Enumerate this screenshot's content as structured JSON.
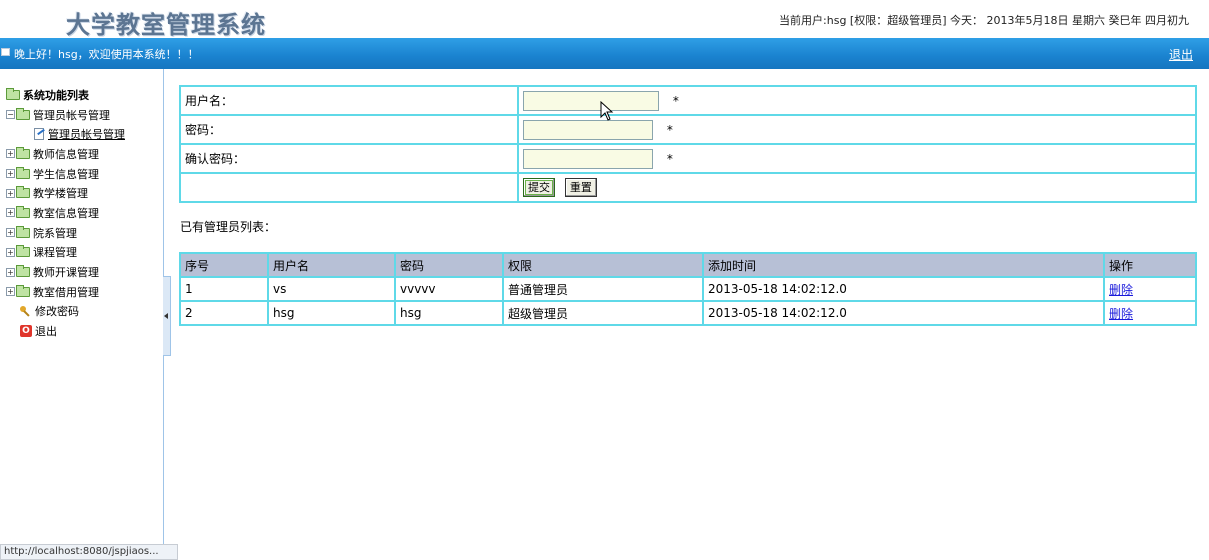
{
  "header": {
    "logo": "大学教室管理系统",
    "user_info": "当前用户:hsg [权限：超级管理员] 今天： 2013年5月18日 星期六 癸巳年 四月初九"
  },
  "nav_bar": {
    "greeting": "晚上好！hsg，欢迎使用本系统！！！",
    "logout": "退出"
  },
  "sidebar": {
    "root": "系统功能列表",
    "items": [
      {
        "label": "管理员帐号管理",
        "expanded": true
      },
      {
        "label": "管理员帐号管理",
        "child": true
      },
      {
        "label": "教师信息管理"
      },
      {
        "label": "学生信息管理"
      },
      {
        "label": "教学楼管理"
      },
      {
        "label": "教室信息管理"
      },
      {
        "label": "院系管理"
      },
      {
        "label": "课程管理"
      },
      {
        "label": "教师开课管理"
      },
      {
        "label": "教室借用管理"
      },
      {
        "label": "修改密码"
      },
      {
        "label": "退出"
      }
    ]
  },
  "form": {
    "username_label": "用户名：",
    "username_value": "",
    "password_label": "密码：",
    "password_value": "",
    "confirm_label": "确认密码：",
    "confirm_value": "",
    "required_mark": "*",
    "submit": "提交",
    "reset": "重置"
  },
  "list": {
    "title": "已有管理员列表：",
    "columns": [
      "序号",
      "用户名",
      "密码",
      "权限",
      "添加时间",
      "操作"
    ],
    "rows": [
      [
        "1",
        "vs",
        "vvvvv",
        "普通管理员",
        "2013-05-18 14:02:12.0",
        "删除"
      ],
      [
        "2",
        "hsg",
        "hsg",
        "超级管理员",
        "2013-05-18 14:02:12.0",
        "删除"
      ]
    ]
  },
  "status_bar": "http://localhost:8080/jspjiaos..."
}
